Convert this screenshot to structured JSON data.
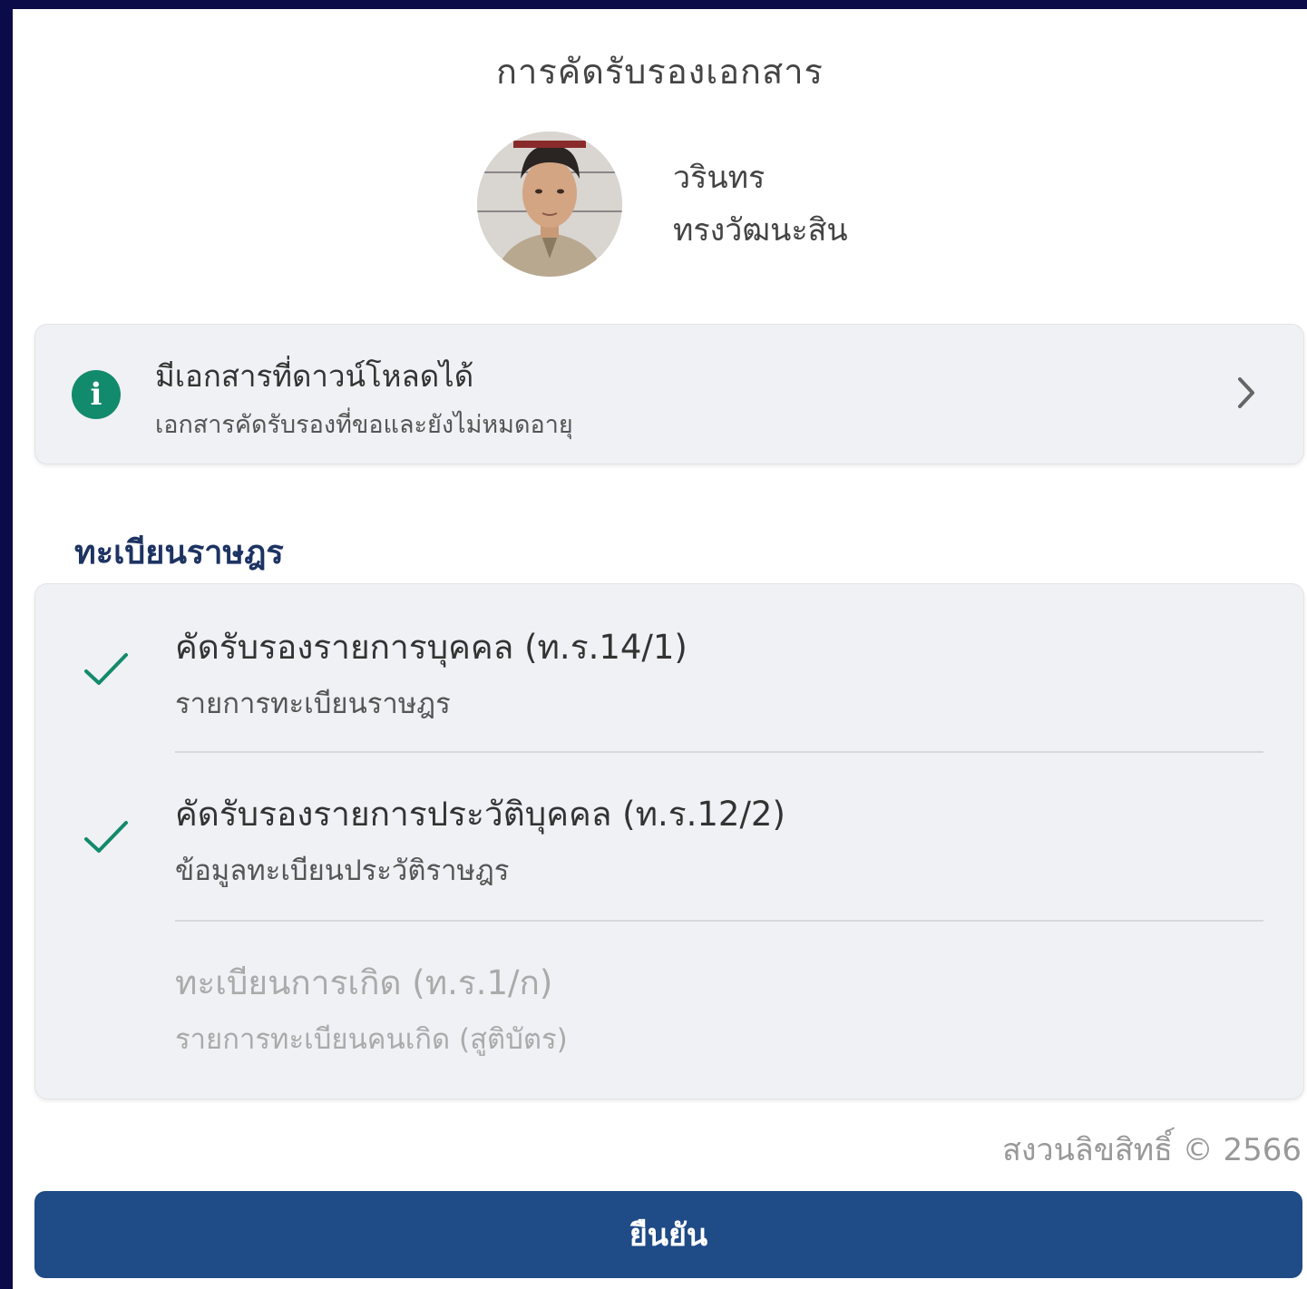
{
  "header": {
    "title": "การคัดรับรองเอกสาร"
  },
  "profile": {
    "first_name": "วรินทร",
    "last_name": "ทรงวัฒนะสิน"
  },
  "notice": {
    "title": "มีเอกสารที่ดาวน์โหลดได้",
    "subtitle": "เอกสารคัดรับรองที่ขอและยังไม่หมดอายุ",
    "icon": "info-icon",
    "icon_glyph": "i"
  },
  "section": {
    "title": "ทะเบียนราษฎร",
    "items": [
      {
        "title": "คัดรับรองรายการบุคคล (ท.ร.14/1)",
        "subtitle": "รายการทะเบียนราษฎร",
        "selected": true
      },
      {
        "title": "คัดรับรองรายการประวัติบุคคล (ท.ร.12/2)",
        "subtitle": "ข้อมูลทะเบียนประวัติราษฎร",
        "selected": true
      },
      {
        "title": "ทะเบียนการเกิด (ท.ร.1/ก)",
        "subtitle": "รายการทะเบียนคนเกิด (สูติบัตร)",
        "selected": false,
        "disabled": true
      }
    ]
  },
  "footer": {
    "copyright": "สงวนลิขสิทธิ์ © 2566",
    "confirm_label": "ยืนยัน"
  },
  "colors": {
    "navy": "#1f4b86",
    "accent_green": "#128a6c",
    "frame": "#0b0b4a"
  }
}
